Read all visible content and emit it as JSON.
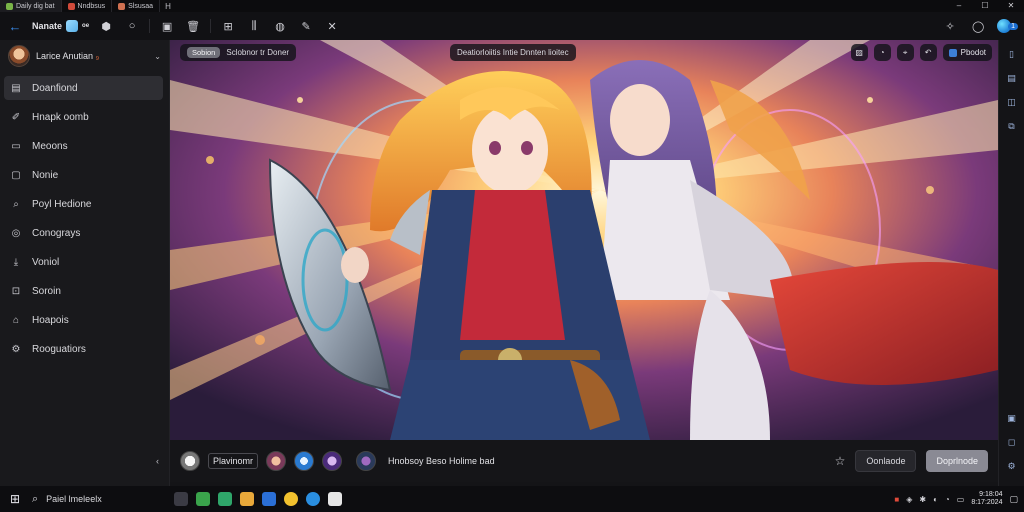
{
  "window": {
    "tabs": [
      {
        "label": "Daily dig bat",
        "color": "#7ab548"
      },
      {
        "label": "Nndbsus",
        "color": "#d04a3a"
      },
      {
        "label": "Slsusaa",
        "color": "#d07050"
      }
    ],
    "tab_extra": "H",
    "controls": [
      "–",
      "☐",
      "✕"
    ]
  },
  "toolbar": {
    "back_icon": "back-arrow-icon",
    "app_name": "Nanate",
    "app_badge": "ᵒᵉ",
    "icons": [
      "shield-icon",
      "circle-icon",
      "square-icon",
      "trash-icon",
      "bookmark-plus-icon",
      "stats-icon",
      "palette-icon",
      "pen-icon",
      "close-icon"
    ],
    "right_icons": [
      "puzzle-icon",
      "chat-icon",
      "edge-icon",
      "badge"
    ],
    "badge_count": "1"
  },
  "sidebar": {
    "profile_name": "Larice Anutian",
    "profile_suffix": "₉",
    "items": [
      {
        "label": "Doanfiond",
        "icon": "home-icon",
        "active": true
      },
      {
        "label": "Hnapk oomb",
        "icon": "brush-icon",
        "active": false
      },
      {
        "label": "Meoons",
        "icon": "folder-icon",
        "active": false
      },
      {
        "label": "Nonie",
        "icon": "image-icon",
        "active": false
      },
      {
        "label": "Poyl Hedione",
        "icon": "search-user-icon",
        "active": false
      },
      {
        "label": "Conograys",
        "icon": "globe-icon",
        "active": false
      },
      {
        "label": "Voniol",
        "icon": "download-icon",
        "active": false
      },
      {
        "label": "Soroin",
        "icon": "terminal-icon",
        "active": false
      },
      {
        "label": "Hoapois",
        "icon": "home-outline-icon",
        "active": false
      },
      {
        "label": "Rooguatiors",
        "icon": "settings-icon",
        "active": false
      }
    ]
  },
  "stage": {
    "chip_tag": "Sobion",
    "chip_text": "Sclobnor tr Doner",
    "center_chip": "Deatiorloiitis  Intie  Dnnten lioitec",
    "action_icons": [
      "image-icon",
      "timer-icon",
      "crop-icon",
      "undo-icon"
    ],
    "publish_label": "Pbodot"
  },
  "promptbar": {
    "user_name": "Plavinomr",
    "prompt_text": "Hnobsoy Beso Holime bad",
    "secondary_btn": "Oonlaode",
    "primary_btn": "Doprlnode"
  },
  "taskbar": {
    "search_text": "Paiel lmeleelx",
    "apps": [
      {
        "name": "task-view-icon",
        "color": "#3b3b44"
      },
      {
        "name": "explorer-icon",
        "color": "#3aa34b"
      },
      {
        "name": "spreadsheet-icon",
        "color": "#2fa66a"
      },
      {
        "name": "folder-icon",
        "color": "#e8a83a"
      },
      {
        "name": "word-icon",
        "color": "#2b6fd6"
      },
      {
        "name": "chrome-icon",
        "color": "#f2c12e"
      },
      {
        "name": "edge-icon",
        "color": "#2a8ee0"
      },
      {
        "name": "store-icon",
        "color": "#e6e6e6"
      }
    ],
    "clock_time": "9:18:04",
    "clock_date": "8:17:2024"
  },
  "colors": {
    "accent": "#1c6fd1",
    "sidebar_bg": "#19191c",
    "active_item": "#2e2e33"
  }
}
